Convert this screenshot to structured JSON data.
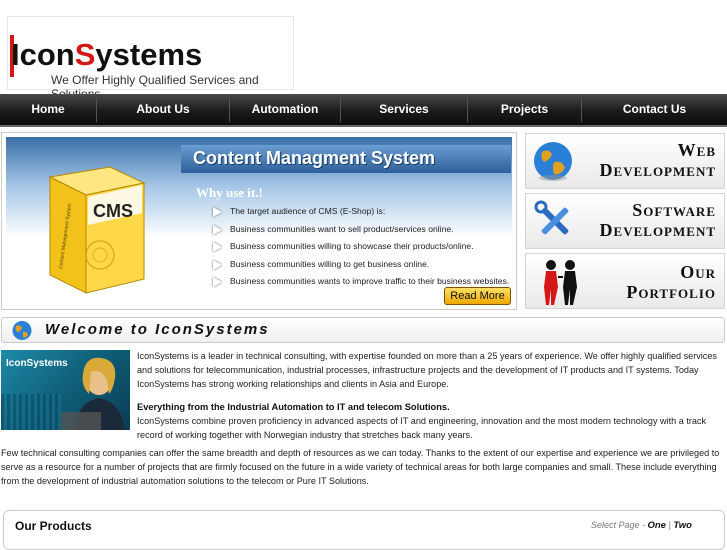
{
  "header": {
    "logo_part1": "Icon",
    "logo_part2": "S",
    "logo_part3": "ystems",
    "tagline": "We Offer Highly Qualified Services and Solutions"
  },
  "nav": {
    "items": [
      "Home",
      "About Us",
      "Automation",
      "Services",
      "Projects",
      "Contact Us"
    ]
  },
  "banner": {
    "title": "Content Managment System",
    "box_label": "CMS",
    "box_side": "Content Management System",
    "why": "Why use it.!",
    "bullets": [
      "The target audience of CMS (E-Shop) is:",
      "Business communities want to sell product/services online.",
      "Business communities willing to showcase their products/online.",
      "Business communities willing to get business online.",
      "Business communities wants to improve traffic to their business websites."
    ],
    "read_more": "Read More"
  },
  "side_panels": [
    {
      "line1": "Web",
      "line2": "Development",
      "icon": "globe-icon"
    },
    {
      "line1": "Software",
      "line2": "Development",
      "icon": "tools-icon"
    },
    {
      "line1": "Our",
      "line2": "Portfolio",
      "icon": "people-icon"
    }
  ],
  "welcome": {
    "title": "Welcome to IconSystems"
  },
  "content": {
    "thumb_label": "IconSystems",
    "para1": "IconSystems is a leader in technical consulting, with expertise founded on more than a 25 years of experience. We offer highly qualified services and solutions for telecommunication, industrial processes, infrastructure projects and the development of IT products and IT systems. Today IconSystems has strong working relationships and clients in Asia and Europe.",
    "bold_line": "Everything from the Industrial Automation to IT and telecom Solutions.",
    "para2": "IconSystems combine proven proficiency in advanced aspects of IT and engineering, innovation and the most modern technology with a track record of working together with Norwegian industry that stretches back many years.",
    "para3": "Few technical consulting companies can offer the same breadth and depth of resources as we can today. Thanks to the extent of our expertise and experience we are privileged to serve as a resource for a number of projects that are firmly focused on the future in a wide variety of technical areas for both large companies and small. These include everything from the development of industrial automation solutions to the telecom or Pure IT Solutions."
  },
  "products": {
    "title": "Our Products",
    "select_page": "Select Page -",
    "page_one": "One",
    "sep": "|",
    "page_two": "Two"
  },
  "colors": {
    "accent_red": "#d41818",
    "nav_dark": "#1b1b1b",
    "banner_blue": "#2d5f9a",
    "button_gold": "#f0a800"
  }
}
